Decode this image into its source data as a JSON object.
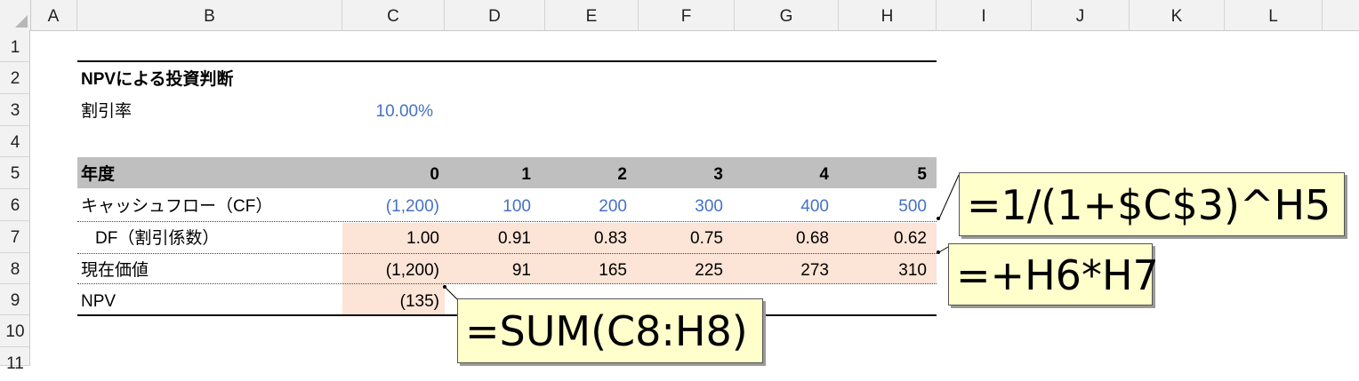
{
  "sheet": {
    "columns": [
      "A",
      "B",
      "C",
      "D",
      "E",
      "F",
      "G",
      "H",
      "I",
      "J",
      "K",
      "L"
    ],
    "rows": [
      "1",
      "2",
      "3",
      "4",
      "5",
      "6",
      "7",
      "8",
      "9",
      "10",
      "11"
    ]
  },
  "content": {
    "title": "NPVによる投資判断",
    "rate_label": "割引率",
    "rate_value": "10.00%",
    "year_label": "年度",
    "years": [
      "0",
      "1",
      "2",
      "3",
      "4",
      "5"
    ],
    "cf_label": "キャッシュフロー（CF）",
    "cf_values": [
      "(1,200)",
      "100",
      "200",
      "300",
      "400",
      "500"
    ],
    "df_label": "DF（割引係数）",
    "df_values": [
      "1.00",
      "0.91",
      "0.83",
      "0.75",
      "0.68",
      "0.62"
    ],
    "pv_label": "現在価値",
    "pv_values": [
      "(1,200)",
      "91",
      "165",
      "225",
      "273",
      "310"
    ],
    "npv_label": "NPV",
    "npv_value": "(135)"
  },
  "callouts": {
    "df_formula": "=1/(1+$C$3)^H5",
    "pv_formula": "=+H6*H7",
    "npv_formula": "=SUM(C8:H8)"
  },
  "colors": {
    "input_blue": "#4472c4",
    "header_gray": "#bfbfbf",
    "formula_fill": "#fce4d6",
    "callout_bg": "#ffffcc"
  }
}
